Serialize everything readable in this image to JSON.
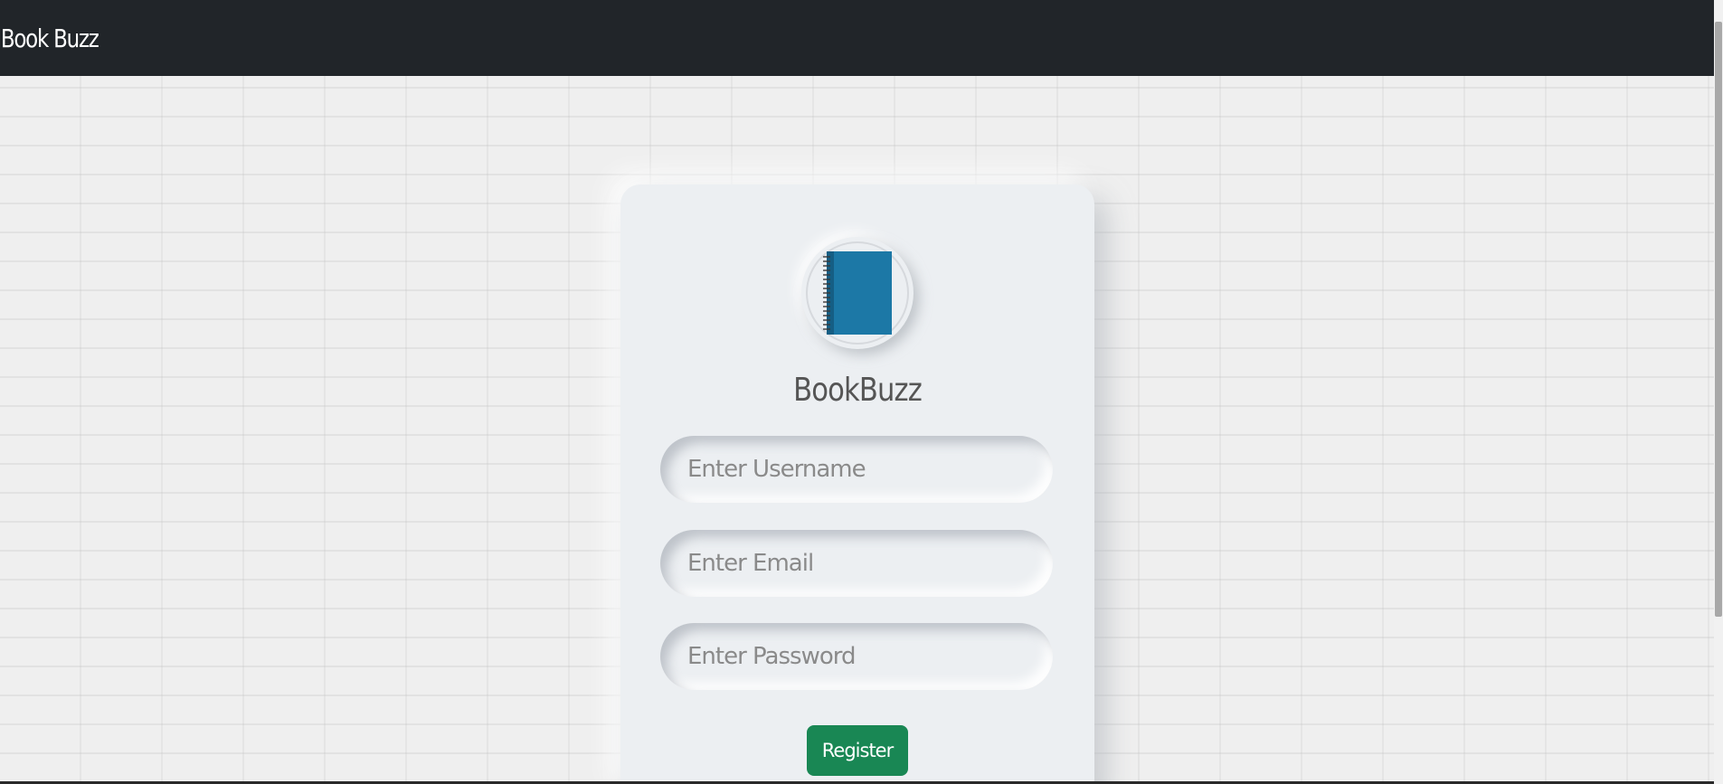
{
  "navbar": {
    "brand": "Book Buzz"
  },
  "card": {
    "logo_icon": "notebook-icon",
    "title": "BookBuzz",
    "fields": {
      "username": {
        "placeholder": "Enter Username",
        "value": ""
      },
      "email": {
        "placeholder": "Enter Email",
        "value": ""
      },
      "password": {
        "placeholder": "Enter Password",
        "value": ""
      }
    },
    "register_label": "Register"
  },
  "colors": {
    "navbar_bg": "#212529",
    "card_bg": "#eceff2",
    "button_bg": "#198754",
    "notebook_cover": "#1c78a6"
  }
}
